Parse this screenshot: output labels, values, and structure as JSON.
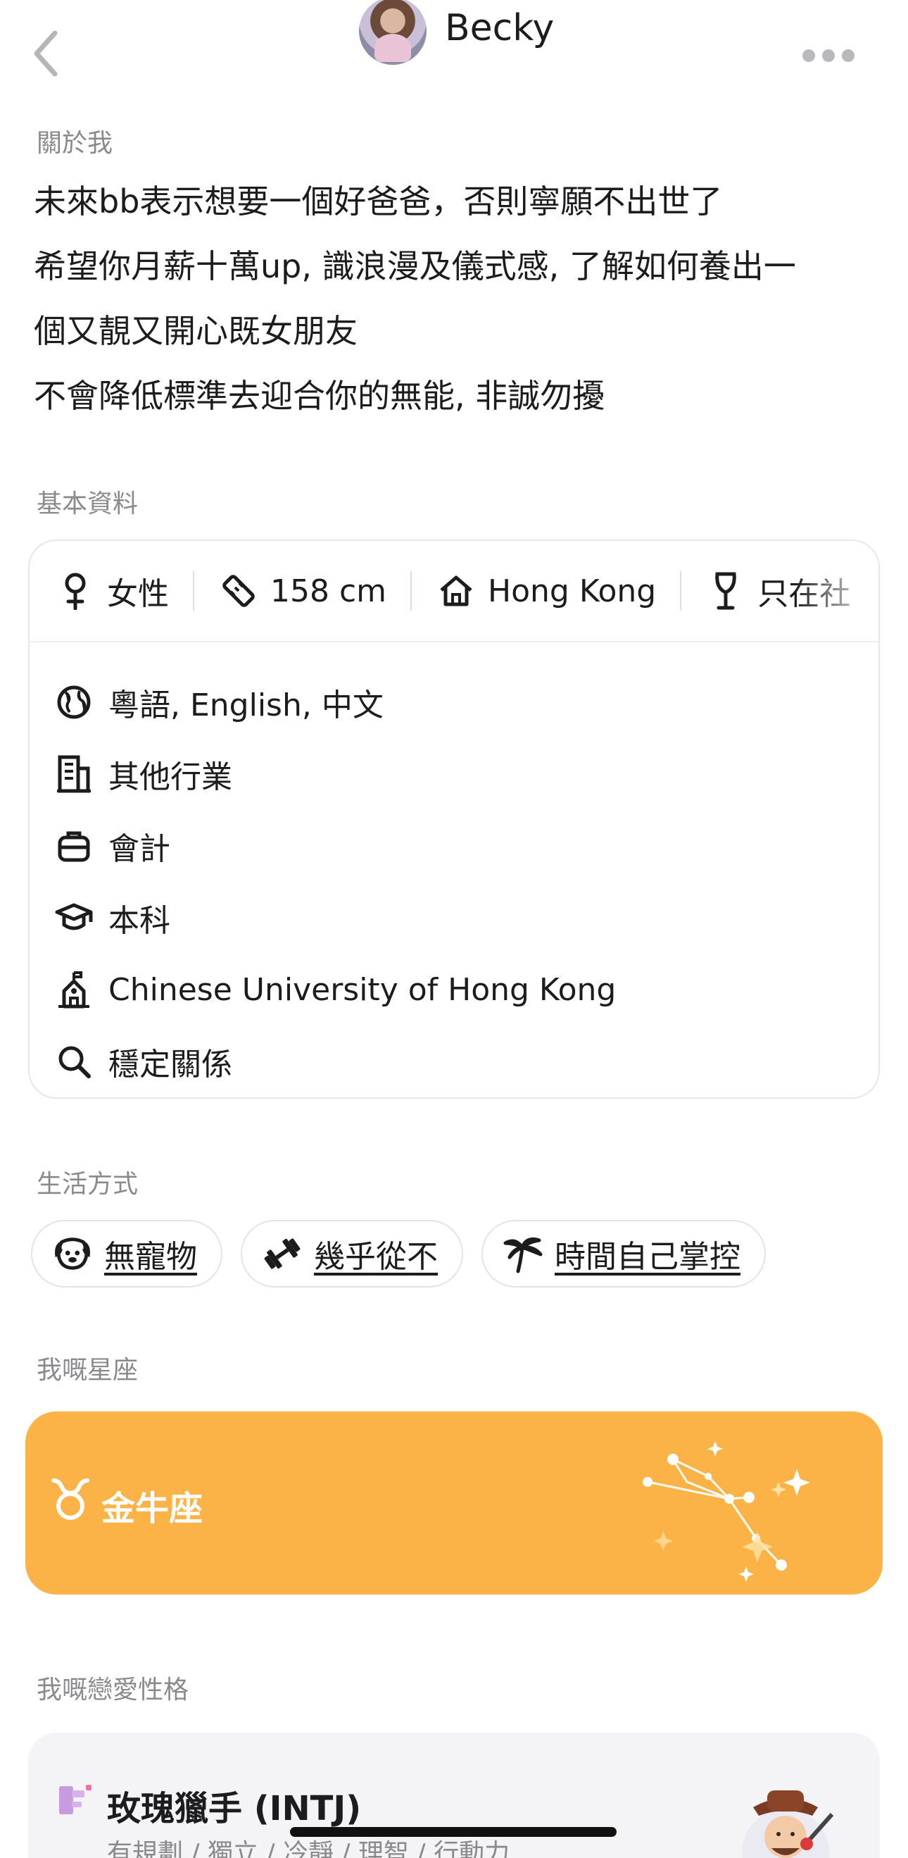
{
  "header": {
    "name": "Becky",
    "back_icon": "chevron-left-icon",
    "more_icon": "ellipsis-icon"
  },
  "about": {
    "title": "關於我",
    "lines": [
      "未來bb表示想要一個好爸爸，否則寧願不出世了",
      "希望你月薪十萬up, 識浪漫及儀式感, 了解如何養出一",
      "個又靚又開心既女朋友",
      "不會降低標準去迎合你的無能, 非誠勿擾"
    ]
  },
  "basic": {
    "title": "基本資料",
    "chips": [
      {
        "icon": "female-icon",
        "label": "女性"
      },
      {
        "icon": "ruler-icon",
        "label": "158 cm"
      },
      {
        "icon": "home-icon",
        "label": "Hong Kong"
      },
      {
        "icon": "wine-glass-icon",
        "label": "只在社"
      }
    ],
    "rows": [
      {
        "icon": "globe-icon",
        "label": "粵語, English, 中文"
      },
      {
        "icon": "building-icon",
        "label": "其他行業"
      },
      {
        "icon": "briefcase-icon",
        "label": "會計"
      },
      {
        "icon": "graduation-cap-icon",
        "label": "本科"
      },
      {
        "icon": "school-icon",
        "label": "Chinese University of Hong Kong"
      },
      {
        "icon": "search-icon",
        "label": "穩定關係"
      }
    ]
  },
  "lifestyle": {
    "title": "生活方式",
    "pills": [
      {
        "icon": "dog-icon",
        "label": "無寵物"
      },
      {
        "icon": "dumbbell-icon",
        "label": "幾乎從不"
      },
      {
        "icon": "palm-tree-icon",
        "label": "時間自己掌控"
      }
    ]
  },
  "zodiac": {
    "title": "我嘅星座",
    "label": "金牛座",
    "icon": "taurus-icon",
    "card_color": "#fbb347"
  },
  "mbti": {
    "title": "我嘅戀愛性格",
    "label": "玫瑰獵手 (INTJ)",
    "traits": "有規劃 / 獨立 / 冷靜 / 理智 / 行動力",
    "icon": "mbti-badge-icon"
  }
}
